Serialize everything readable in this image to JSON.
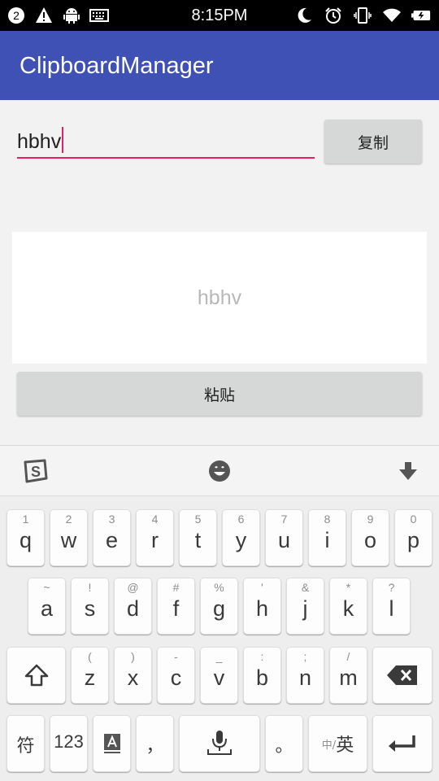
{
  "status_bar": {
    "notification_count": "2",
    "time": "8:15PM",
    "icons_left": [
      "notification-count-icon",
      "warning-icon",
      "android-icon",
      "keyboard-icon"
    ],
    "icons_right": [
      "moon-icon",
      "alarm-icon",
      "vibrate-icon",
      "wifi-icon",
      "battery-icon"
    ]
  },
  "app_bar": {
    "title": "ClipboardManager"
  },
  "main": {
    "input_value": "hbhv",
    "copy_label": "复制",
    "display_text": "hbhv",
    "paste_label": "粘贴"
  },
  "keyboard": {
    "toolbar_icons": [
      "sogou-logo-icon",
      "emoji-icon",
      "hide-keyboard-icon"
    ],
    "row1": [
      {
        "hint": "1",
        "key": "q"
      },
      {
        "hint": "2",
        "key": "w"
      },
      {
        "hint": "3",
        "key": "e"
      },
      {
        "hint": "4",
        "key": "r"
      },
      {
        "hint": "5",
        "key": "t"
      },
      {
        "hint": "6",
        "key": "y"
      },
      {
        "hint": "7",
        "key": "u"
      },
      {
        "hint": "8",
        "key": "i"
      },
      {
        "hint": "9",
        "key": "o"
      },
      {
        "hint": "0",
        "key": "p"
      }
    ],
    "row2": [
      {
        "hint": "~",
        "key": "a"
      },
      {
        "hint": "!",
        "key": "s"
      },
      {
        "hint": "@",
        "key": "d"
      },
      {
        "hint": "#",
        "key": "f"
      },
      {
        "hint": "%",
        "key": "g"
      },
      {
        "hint": "'",
        "key": "h"
      },
      {
        "hint": "&",
        "key": "j"
      },
      {
        "hint": "*",
        "key": "k"
      },
      {
        "hint": "?",
        "key": "l"
      }
    ],
    "row3": [
      {
        "hint": "(",
        "key": "z"
      },
      {
        "hint": ")",
        "key": "x"
      },
      {
        "hint": "-",
        "key": "c"
      },
      {
        "hint": "_",
        "key": "v"
      },
      {
        "hint": ":",
        "key": "b"
      },
      {
        "hint": ";",
        "key": "n"
      },
      {
        "hint": "/",
        "key": "m"
      }
    ],
    "bottom": {
      "symbols": "符",
      "numbers": "123",
      "comma": "，",
      "period": "。",
      "lang_small": "中/",
      "lang_big": "英"
    }
  }
}
